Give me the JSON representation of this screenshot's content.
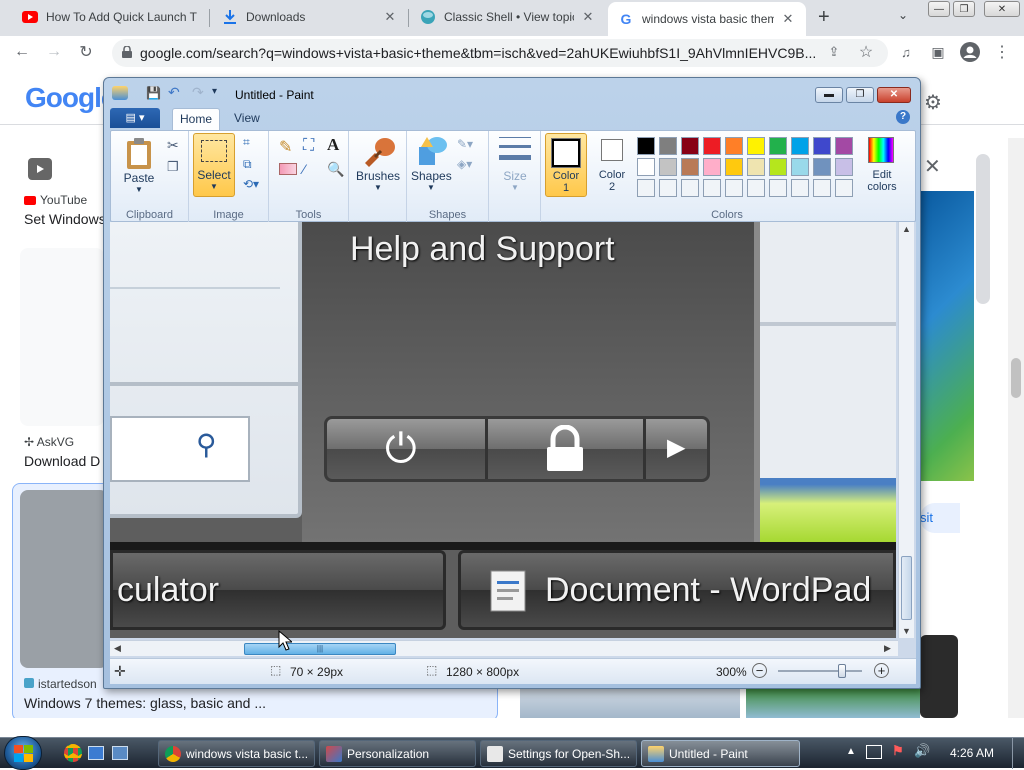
{
  "browser": {
    "tabs": [
      {
        "label": "How To Add Quick Launch T",
        "icon": "youtube-icon"
      },
      {
        "label": "Downloads",
        "icon": "download-icon"
      },
      {
        "label": "Classic Shell • View topic - ",
        "icon": "shell-icon"
      },
      {
        "label": "windows vista basic theme",
        "icon": "google-icon",
        "active": true
      }
    ],
    "url": "google.com/search?q=windows+vista+basic+theme&tbm=isch&ved=2ahUKEwiuhbfS1I_9AhVlmnIEHVC9B..."
  },
  "google": {
    "logo": "Google",
    "results": [
      {
        "source": "YouTube",
        "title": "Set Windows"
      },
      {
        "source": "AskVG",
        "title": "Download D"
      },
      {
        "source": "istartedson",
        "title": "Windows 7 themes: glass, basic and ..."
      }
    ],
    "visit_label": "sit"
  },
  "paint": {
    "title": "Untitled - Paint",
    "tabs": {
      "home": "Home",
      "view": "View"
    },
    "groups": {
      "clipboard": "Clipboard",
      "image": "Image",
      "tools": "Tools",
      "shapes": "Shapes",
      "colors": "Colors"
    },
    "buttons": {
      "paste": "Paste",
      "select": "Select",
      "brushes": "Brushes",
      "shapes": "Shapes",
      "size": "Size",
      "color1": "Color\n1",
      "color2": "Color\n2",
      "edit_colors": "Edit\ncolors"
    },
    "palette_row1": [
      "#000000",
      "#7f7f7f",
      "#880015",
      "#ed1c24",
      "#ff7f27",
      "#fff200",
      "#22b14c",
      "#00a2e8",
      "#3f48cc",
      "#a349a4"
    ],
    "palette_row2": [
      "#ffffff",
      "#c3c3c3",
      "#b97a57",
      "#ffaec9",
      "#ffc90e",
      "#efe4b0",
      "#b5e61d",
      "#99d9ea",
      "#7092be",
      "#c8bfe7"
    ],
    "canvas_texts": {
      "help": "Help and Support",
      "calc": "culator",
      "wordpad": "Document - WordPad"
    },
    "status": {
      "selection": "70 × 29px",
      "image_size": "1280 × 800px",
      "zoom": "300%",
      "zoom_value_pct": 300
    }
  },
  "taskbar": {
    "buttons": [
      {
        "label": "windows vista basic t..."
      },
      {
        "label": "Personalization"
      },
      {
        "label": "Settings for Open-Sh..."
      },
      {
        "label": "Untitled - Paint"
      }
    ],
    "clock": "4:26 AM"
  }
}
